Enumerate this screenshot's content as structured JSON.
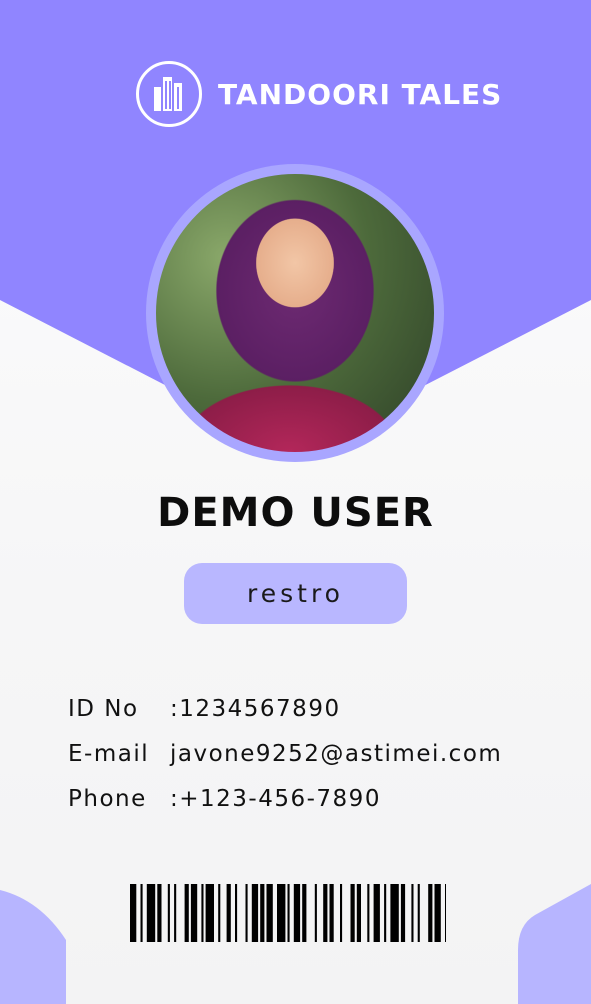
{
  "brand": {
    "name": "TANDOORI TALES",
    "logo_icon": "buildings-icon"
  },
  "profile": {
    "photo_icon": "user-photo",
    "name": "DEMO USER",
    "role": "restro"
  },
  "details": [
    {
      "label": "ID No",
      "value": ":1234567890"
    },
    {
      "label": "E-mail",
      "value": "javone9252@astimei.com"
    },
    {
      "label": "Phone",
      "value": ":+123-456-7890"
    }
  ],
  "colors": {
    "header": "#9085ff",
    "accent": "#b9b7ff",
    "ring": "#a9a6ff",
    "corner": "#b7b5ff"
  }
}
